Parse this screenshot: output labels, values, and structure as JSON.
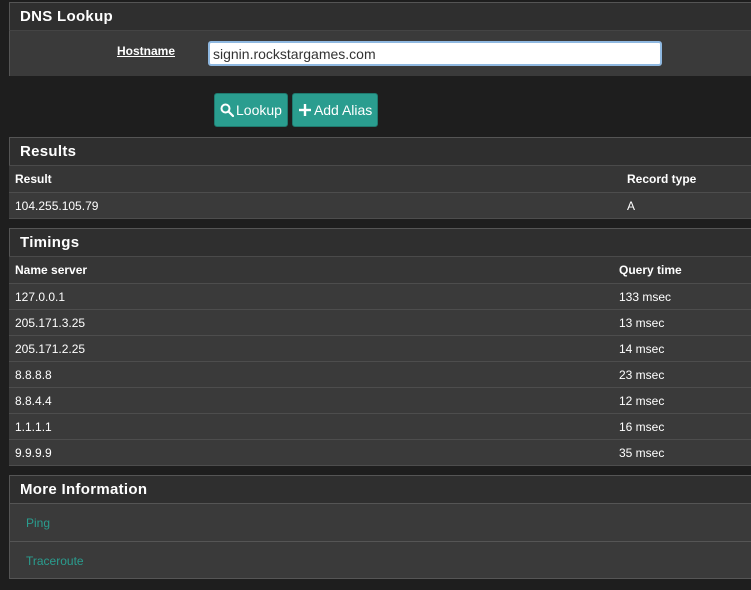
{
  "dns_lookup": {
    "title": "DNS Lookup",
    "hostname_label": "Hostname",
    "hostname_value": "signin.rockstargames.com",
    "lookup_button": "Lookup",
    "add_alias_button": "Add Alias"
  },
  "results": {
    "title": "Results",
    "columns": [
      "Result",
      "Record type"
    ],
    "rows": [
      {
        "result": "104.255.105.79",
        "type": "A"
      }
    ]
  },
  "timings": {
    "title": "Timings",
    "columns": [
      "Name server",
      "Query time"
    ],
    "rows": [
      {
        "server": "127.0.0.1",
        "time": "133 msec"
      },
      {
        "server": "205.171.3.25",
        "time": "13 msec"
      },
      {
        "server": "205.171.2.25",
        "time": "14 msec"
      },
      {
        "server": "8.8.8.8",
        "time": "23 msec"
      },
      {
        "server": "8.8.4.4",
        "time": "12 msec"
      },
      {
        "server": "1.1.1.1",
        "time": "16 msec"
      },
      {
        "server": "9.9.9.9",
        "time": "35 msec"
      }
    ]
  },
  "more_info": {
    "title": "More Information",
    "links": [
      "Ping",
      "Traceroute"
    ]
  },
  "colors": {
    "accent": "#2a9d8f",
    "background": "#1e1e1e",
    "panel": "#3a3a3a"
  },
  "icons": {
    "lookup": "search-icon",
    "add_alias": "plus-icon"
  }
}
